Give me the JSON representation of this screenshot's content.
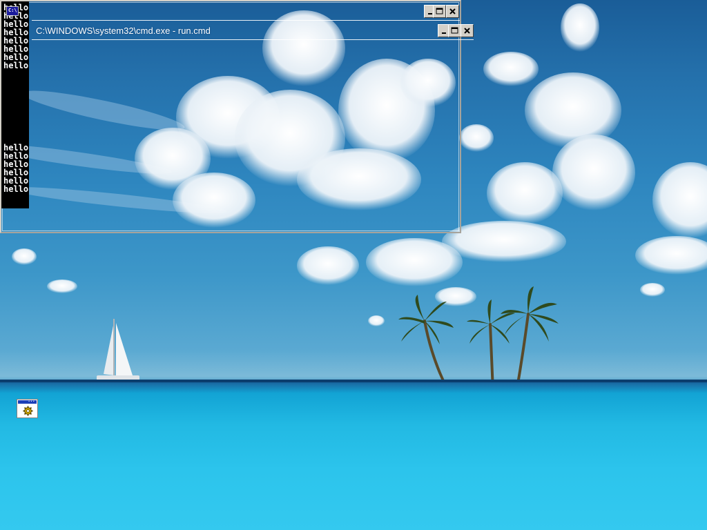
{
  "desktop": {
    "wallpaper": "tropical-island-ocean",
    "shortcut_icon": "console-application-icon"
  },
  "console_window": {
    "sys_icon_label": "C:\\",
    "lines": [
      "hello",
      "hello",
      "hello",
      "hello",
      "hello",
      "hello",
      "hello",
      "hello",
      "hello",
      "hello",
      "hello",
      "hello",
      "hello",
      "hello"
    ],
    "buttons": [
      "minimize",
      "maximize",
      "close"
    ]
  },
  "cmd_window": {
    "title": "C:\\WINDOWS\\system32\\cmd.exe - run.cmd",
    "buttons": [
      "minimize",
      "maximize",
      "close"
    ]
  },
  "colors": {
    "sky": "#2e86bf",
    "sea": "#22b9e3",
    "console_bg": "#000000",
    "console_text": "#ffffff"
  }
}
